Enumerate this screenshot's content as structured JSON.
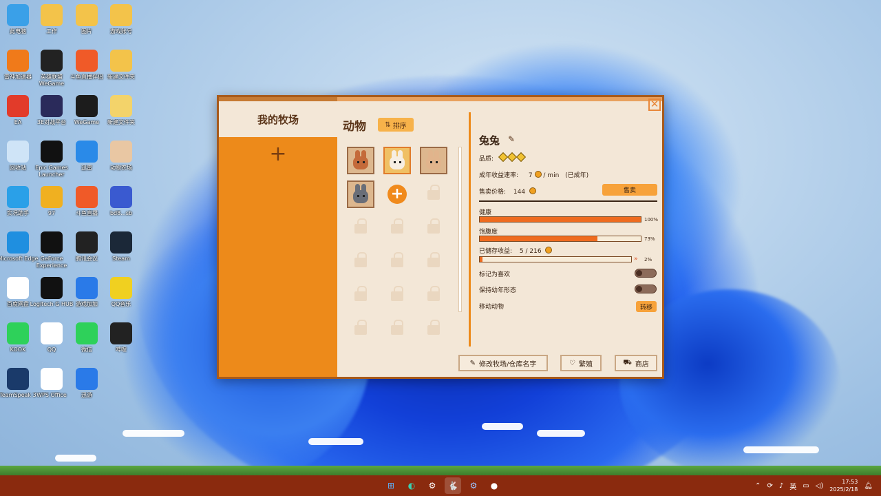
{
  "desktop_icons": [
    {
      "label": "此电脑",
      "icon": "computer-icon",
      "color": "#3aa0e8"
    },
    {
      "label": "工作",
      "icon": "folder-icon",
      "color": "#f3c34a"
    },
    {
      "label": "图片",
      "icon": "folder-icon",
      "color": "#f3c34a"
    },
    {
      "label": "游戏账号",
      "icon": "folder-icon",
      "color": "#f3c34a"
    },
    {
      "label": "雷神加速器",
      "icon": "leishen-icon",
      "color": "#f07a1a"
    },
    {
      "label": "英雄联盟WeGame",
      "icon": "lol-icon",
      "color": "#222222"
    },
    {
      "label": "斗鱼直播伴侣",
      "icon": "douyu-icon",
      "color": "#f05a28"
    },
    {
      "label": "新建文件夹",
      "icon": "folder-icon",
      "color": "#f3c34a"
    },
    {
      "label": "EA",
      "icon": "ea-icon",
      "color": "#e23b2a"
    },
    {
      "label": "3E对战平台",
      "icon": "3e-icon",
      "color": "#2a2a5a"
    },
    {
      "label": "WeGame",
      "icon": "wegame-icon",
      "color": "#1c1c1c"
    },
    {
      "label": "新建文件夹",
      "icon": "folder-icon",
      "color": "#f3d36a"
    },
    {
      "label": "回收站",
      "icon": "recycle-bin-icon",
      "color": "#cfe4f7"
    },
    {
      "label": "Epic Games Launcher",
      "icon": "epic-icon",
      "color": "#111111"
    },
    {
      "label": "迅雷",
      "icon": "xunlei-icon",
      "color": "#2a8ae8"
    },
    {
      "label": "动物农场",
      "icon": "rabbit-icon",
      "color": "#e9c7a3"
    },
    {
      "label": "实况助手",
      "icon": "monitor-icon",
      "color": "#2aa0e8"
    },
    {
      "label": "97",
      "icon": "owl-icon",
      "color": "#f0b020"
    },
    {
      "label": "斗鱼直播",
      "icon": "douyu-icon",
      "color": "#f05a28"
    },
    {
      "label": "bd8...sb",
      "icon": "file-icon",
      "color": "#3a5ad0"
    },
    {
      "label": "Microsoft Edge",
      "icon": "edge-icon",
      "color": "#1f8fe0"
    },
    {
      "label": "GeForce Experience",
      "icon": "nvidia-icon",
      "color": "#111111"
    },
    {
      "label": "腾讯会议",
      "icon": "v-icon",
      "color": "#222222"
    },
    {
      "label": "Steam",
      "icon": "steam-icon",
      "color": "#1b2838"
    },
    {
      "label": "百度网盘",
      "icon": "baidu-icon",
      "color": "#ffffff"
    },
    {
      "label": "Logitech G HUB",
      "icon": "logitech-icon",
      "color": "#111111"
    },
    {
      "label": "游戏加加",
      "icon": "gplus-icon",
      "color": "#2a7ae8"
    },
    {
      "label": "QQ音乐",
      "icon": "qqmusic-icon",
      "color": "#f0d020"
    },
    {
      "label": "KOOK",
      "icon": "kook-icon",
      "color": "#2ed15a"
    },
    {
      "label": "QQ",
      "icon": "qq-icon",
      "color": "#ffffff"
    },
    {
      "label": "微信",
      "icon": "wechat-icon",
      "color": "#2ed15a"
    },
    {
      "label": "哔哩",
      "icon": "bili-icon",
      "color": "#222222"
    },
    {
      "label": "TeamSpeak 3",
      "icon": "teamspeak-icon",
      "color": "#1a3a6a"
    },
    {
      "label": "WPS Office",
      "icon": "wps-icon",
      "color": "#ffffff"
    },
    {
      "label": "迅游",
      "icon": "xunyou-icon",
      "color": "#2a7ae8"
    }
  ],
  "window": {
    "left_title": "我的牧场",
    "mid_title": "动物",
    "sort_label": "排序",
    "close": "✕"
  },
  "animals": [
    {
      "name": "brown-rabbit",
      "fur": "#c46a3a",
      "selected": false
    },
    {
      "name": "white-rabbit",
      "fur": "#f6eee2",
      "selected": true
    },
    {
      "name": "tan-rabbit",
      "fur": "#e1b48c",
      "selected": false
    },
    {
      "name": "grey-rabbit",
      "fur": "#6a6e78",
      "selected": false
    }
  ],
  "detail": {
    "name": "兔兔",
    "quality_label": "品质:",
    "income_label": "成年收益速率:",
    "income_value": "7",
    "income_unit": "/ min",
    "income_note": "(已成年)",
    "price_label": "售卖价格:",
    "price_value": "144",
    "sell_label": "售卖",
    "health_label": "健康",
    "health_pct": "100%",
    "health_value": 100,
    "full_label": "饱腹度",
    "full_pct": "73%",
    "full_value": 73,
    "stored_label": "已储存收益:",
    "stored_value": "5 / 216",
    "stored_pct": "2%",
    "stored_fill": 2,
    "fav_label": "标记为喜欢",
    "young_label": "保持幼年形态",
    "move_label": "移动动物",
    "move_btn": "转移"
  },
  "footer": {
    "rename": "修改牧场/仓库名字",
    "breed": "繁殖",
    "shop": "商店"
  },
  "taskbar": {
    "ime": "英",
    "time": "17:53",
    "date": "2025/2/18"
  }
}
